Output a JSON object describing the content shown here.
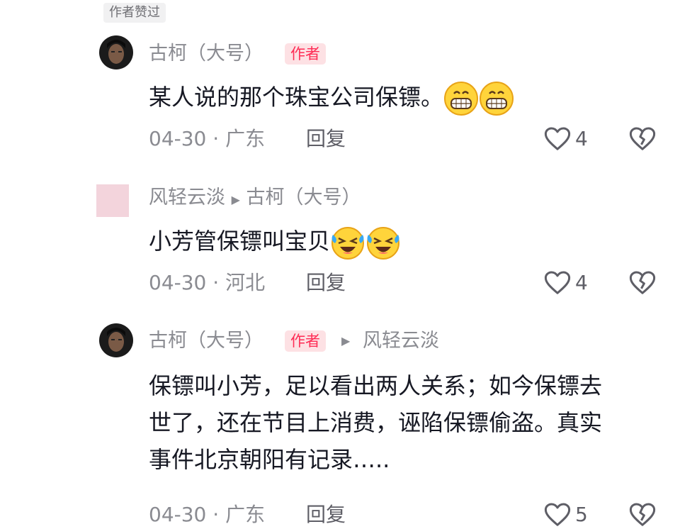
{
  "author_liked": "作者赞过",
  "comments": [
    {
      "username": "古柯（大号）",
      "author_tag": "作者",
      "text": "某人说的那个珠宝公司保镖。",
      "emojis": [
        "grin-emoji",
        "grin-emoji"
      ],
      "date": "04-30",
      "separator": "·",
      "location": "广东",
      "reply_label": "回复",
      "likes": "4"
    },
    {
      "username": "风轻云淡",
      "reply_to": "古柯（大号）",
      "text": "小芳管保镖叫宝贝",
      "emojis": [
        "laughing-crying-emoji",
        "laughing-crying-emoji"
      ],
      "date": "04-30",
      "separator": "·",
      "location": "河北",
      "reply_label": "回复",
      "likes": "4"
    },
    {
      "username": "古柯（大号）",
      "author_tag": "作者",
      "reply_to": "风轻云淡",
      "text_lines": [
        "保镖叫小芳，足以看出两人关系；如今保镖去",
        "世了，还在节目上消费，诬陷保镖偷盗。真实",
        "事件北京朝阳有记录….."
      ],
      "date": "04-30",
      "separator": "·",
      "location": "广东",
      "reply_label": "回复",
      "likes": "5"
    }
  ],
  "colors": {
    "author_tag_bg": "#fde1e4",
    "author_tag_text": "#fe2c55",
    "secondary_text": "#8a8b91",
    "primary_text": "#161823"
  }
}
